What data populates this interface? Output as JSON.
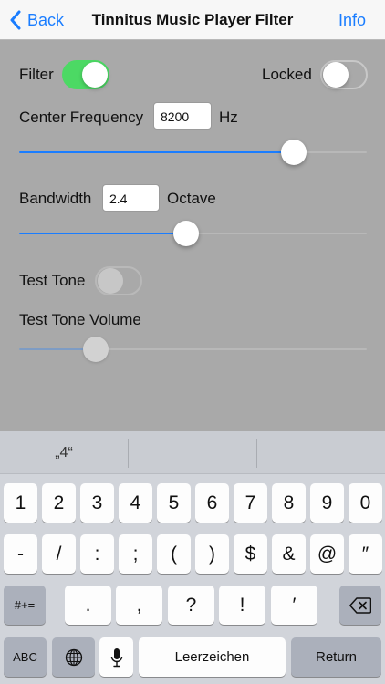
{
  "nav": {
    "back_label": "Back",
    "title": "Tinnitus Music Player Filter",
    "info_label": "Info"
  },
  "filter": {
    "label": "Filter",
    "on": true
  },
  "locked": {
    "label": "Locked",
    "on": false
  },
  "center_frequency": {
    "label": "Center Frequency",
    "value": "8200",
    "unit": "Hz",
    "slider_fraction": 0.79
  },
  "bandwidth": {
    "label": "Bandwidth",
    "value": "2.4",
    "unit": "Octave",
    "slider_fraction": 0.48
  },
  "test_tone": {
    "label": "Test Tone",
    "on": false,
    "enabled": false
  },
  "test_tone_volume": {
    "label": "Test Tone Volume",
    "slider_fraction": 0.22,
    "enabled": false
  },
  "keyboard": {
    "suggestions": [
      "„4“",
      "",
      ""
    ],
    "row1": [
      "1",
      "2",
      "3",
      "4",
      "5",
      "6",
      "7",
      "8",
      "9",
      "0"
    ],
    "row2": [
      "-",
      "/",
      ":",
      ";",
      "(",
      ")",
      "$",
      "&",
      "@",
      "″"
    ],
    "row3_left": "#+=",
    "row3": [
      ".",
      ",",
      "?",
      "!",
      "′"
    ],
    "row4": {
      "abc": "ABC",
      "space": "Leerzeichen",
      "return": "Return"
    },
    "icons": {
      "backspace": "backspace-icon",
      "globe": "globe-icon",
      "mic": "microphone-icon"
    }
  },
  "colors": {
    "accent": "#1a7dff",
    "switch_on": "#4cd964",
    "background": "#a9a9a9",
    "keyboard": "#d1d4da"
  }
}
